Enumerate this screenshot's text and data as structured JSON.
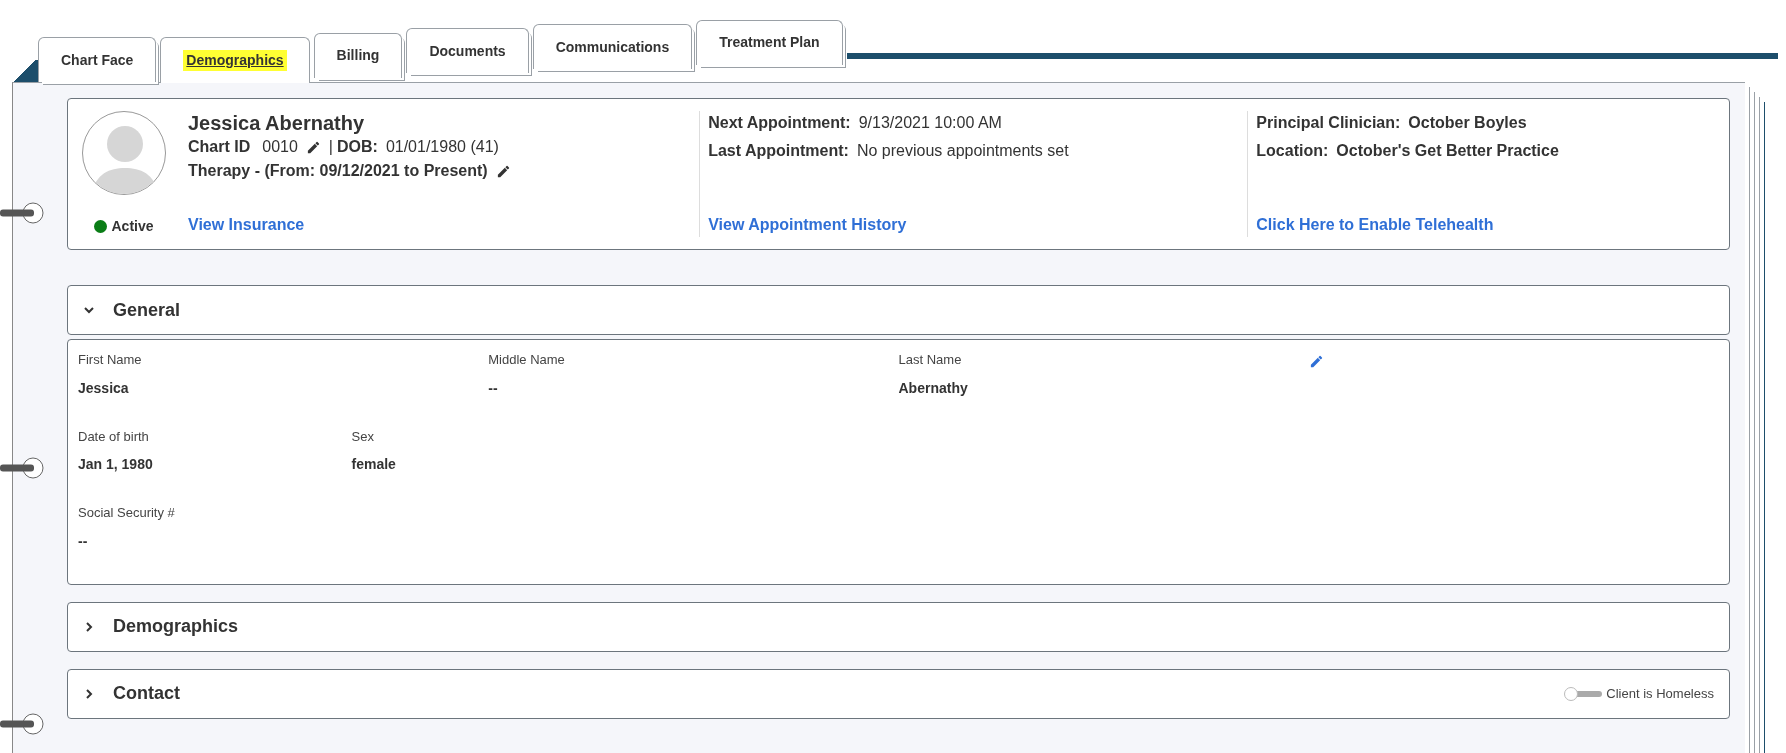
{
  "tabs": [
    {
      "label": "Chart Face",
      "selected": false
    },
    {
      "label": "Demographics",
      "selected": true
    },
    {
      "label": "Billing",
      "selected": false
    },
    {
      "label": "Documents",
      "selected": false
    },
    {
      "label": "Communications",
      "selected": false
    },
    {
      "label": "Treatment Plan",
      "selected": false
    }
  ],
  "client": {
    "name": "Jessica Abernathy",
    "chart_id_label": "Chart ID",
    "chart_id": "0010",
    "separator": "|",
    "dob_label": "DOB:",
    "dob": "01/01/1980 (41)",
    "program": "Therapy - (From: 09/12/2021 to Present)",
    "status": {
      "label": "Active",
      "active": true
    },
    "link": "View Insurance"
  },
  "appointments": {
    "items": [
      {
        "label": "Next Appointment:",
        "value": "9/13/2021 10:00 AM"
      },
      {
        "label": "Last Appointment:",
        "value": "No previous appointments set"
      }
    ],
    "link": "View Appointment History"
  },
  "practice": {
    "items": [
      {
        "label": "Principal Clinician:",
        "value": "October Boyles"
      },
      {
        "label": "Location:",
        "value": "October's Get Better Practice"
      }
    ],
    "link": "Click Here to Enable Telehealth"
  },
  "sections": [
    {
      "title": "General",
      "expanded": true,
      "rows": [
        [
          {
            "label": "First Name",
            "value": "Jessica"
          },
          {
            "label": "Middle Name",
            "value": "--"
          },
          {
            "label": "Last Name",
            "value": "Abernathy"
          }
        ],
        [
          {
            "label": "Date of birth",
            "value": "Jan 1, 1980"
          },
          {
            "label": "Sex",
            "value": "female"
          }
        ],
        [
          {
            "label": "Social Security #",
            "value": "--"
          }
        ]
      ]
    },
    {
      "title": "Demographics",
      "expanded": false
    },
    {
      "title": "Contact",
      "expanded": false,
      "toggle": {
        "label": "Client is Homeless",
        "on": false
      }
    }
  ]
}
